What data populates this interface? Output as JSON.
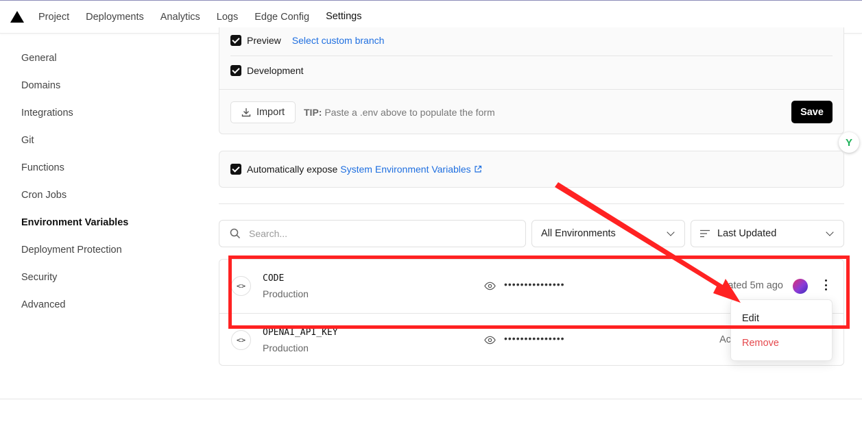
{
  "nav": {
    "items": [
      "Project",
      "Deployments",
      "Analytics",
      "Logs",
      "Edge Config",
      "Settings"
    ],
    "active": "Settings"
  },
  "sidebar": {
    "items": [
      "General",
      "Domains",
      "Integrations",
      "Git",
      "Functions",
      "Cron Jobs",
      "Environment Variables",
      "Deployment Protection",
      "Security",
      "Advanced"
    ],
    "active": "Environment Variables"
  },
  "env_form": {
    "preview_label": "Preview",
    "preview_link": "Select custom branch",
    "development_label": "Development",
    "import_label": "Import",
    "tip_prefix": "TIP:",
    "tip_text": "Paste a .env above to populate the form",
    "save_label": "Save"
  },
  "auto_expose": {
    "label": "Automatically expose",
    "link": "System Environment Variables"
  },
  "filters": {
    "search_placeholder": "Search...",
    "environment": "All Environments",
    "sort": "Last Updated"
  },
  "variables": [
    {
      "name": "CODE",
      "environment": "Production",
      "value": "•••••••••••••••",
      "updated": "dated 5m ago"
    },
    {
      "name": "OPENAI_API_KEY",
      "environment": "Production",
      "value": "•••••••••••••••",
      "updated": "Ac"
    }
  ],
  "menu": {
    "edit": "Edit",
    "remove": "Remove"
  },
  "colors": {
    "accent_link": "#1f6fe0",
    "danger": "#e5484d",
    "annotation": "#ff2222"
  }
}
